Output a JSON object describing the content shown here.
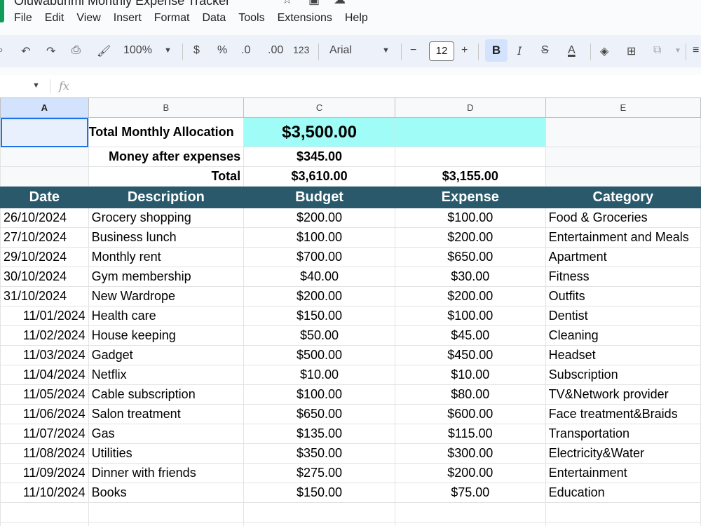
{
  "app": {
    "doc_title": "Oluwabunmi Monthly Expense Tracker",
    "menu": [
      "File",
      "Edit",
      "View",
      "Insert",
      "Format",
      "Data",
      "Tools",
      "Extensions",
      "Help"
    ]
  },
  "toolbar": {
    "zoom": "100%",
    "currency": "$",
    "percent": "%",
    "dec_decrease": ".0",
    "dec_increase": ".00",
    "number_format": "123",
    "font": "Arial",
    "font_size": "12",
    "minus": "−",
    "plus": "+",
    "bold": "B",
    "italic": "I",
    "text_color": "A"
  },
  "formula_bar": {
    "fx": "fx"
  },
  "columns": [
    "A",
    "B",
    "C",
    "D",
    "E"
  ],
  "summary": {
    "alloc_label": "Total Monthly Allocation",
    "alloc_value": "$3,500.00",
    "after_label": "Money after expenses",
    "after_value": "$345.00",
    "total_label": "Total",
    "total_budget": "$3,610.00",
    "total_expense": "$3,155.00"
  },
  "headers": [
    "Date",
    "Description",
    "Budget",
    "Expense",
    "Category"
  ],
  "rows": [
    [
      "26/10/2024",
      "Grocery shopping",
      "$200.00",
      "$100.00",
      "Food & Groceries"
    ],
    [
      "27/10/2024",
      "Business lunch",
      "$100.00",
      "$200.00",
      "Entertainment and Meals"
    ],
    [
      "29/10/2024",
      "Monthly rent",
      "$700.00",
      "$650.00",
      "Apartment"
    ],
    [
      "30/10/2024",
      "Gym membership",
      "$40.00",
      "$30.00",
      "Fitness"
    ],
    [
      "31/10/2024",
      "New Wardrope",
      "$200.00",
      "$200.00",
      "Outfits"
    ],
    [
      "11/01/2024",
      "Health care",
      "$150.00",
      "$100.00",
      "Dentist"
    ],
    [
      "11/02/2024",
      "House keeping",
      "$50.00",
      "$45.00",
      "Cleaning"
    ],
    [
      "11/03/2024",
      "Gadget",
      "$500.00",
      "$450.00",
      "Headset"
    ],
    [
      "11/04/2024",
      "Netflix",
      "$10.00",
      "$10.00",
      "Subscription"
    ],
    [
      "11/05/2024",
      "Cable subscription",
      "$100.00",
      "$80.00",
      "TV&Network provider"
    ],
    [
      "11/06/2024",
      "Salon treatment",
      "$650.00",
      "$600.00",
      "Face treatment&Braids"
    ],
    [
      "11/07/2024",
      "Gas",
      "$135.00",
      "$115.00",
      "Transportation"
    ],
    [
      "11/08/2024",
      "Utilities",
      "$350.00",
      "$300.00",
      "Electricity&Water"
    ],
    [
      "11/09/2024",
      "Dinner with friends",
      "$275.00",
      "$200.00",
      "Entertainment"
    ],
    [
      "11/10/2024",
      "Books",
      "$150.00",
      "$75.00",
      "Education"
    ]
  ],
  "colors": {
    "header_bg": "#29596b",
    "allocation_bg": "#9ffcf6",
    "selection": "#1a73e8"
  }
}
